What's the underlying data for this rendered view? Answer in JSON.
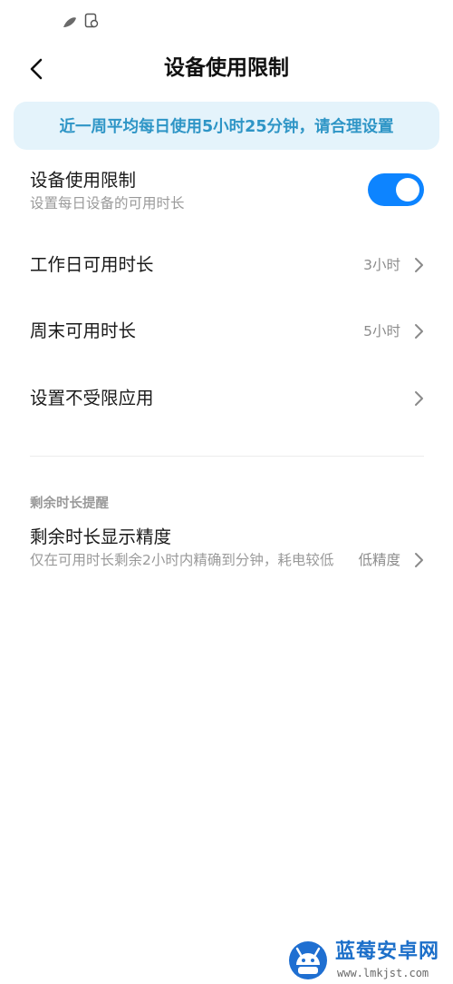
{
  "header": {
    "title": "设备使用限制"
  },
  "banner": {
    "text": "近一周平均每日使用5小时25分钟，请合理设置"
  },
  "settings": [
    {
      "title": "设备使用限制",
      "subtitle": "设置每日设备的可用时长",
      "toggle_on": true
    },
    {
      "title": "工作日可用时长",
      "value": "3小时"
    },
    {
      "title": "周末可用时长",
      "value": "5小时"
    },
    {
      "title": "设置不受限应用"
    }
  ],
  "reminder_section": {
    "label": "剩余时长提醒",
    "item": {
      "title": "剩余时长显示精度",
      "subtitle": "仅在可用时长剩余2小时内精确到分钟，耗电较低",
      "value": "低精度"
    }
  },
  "watermark": {
    "brand": "蓝莓安卓网",
    "url": "www.lmkjst.com"
  },
  "colors": {
    "accent": "#0d84ff",
    "banner_bg": "#e4f3fb",
    "banner_text": "#2e95c6"
  }
}
